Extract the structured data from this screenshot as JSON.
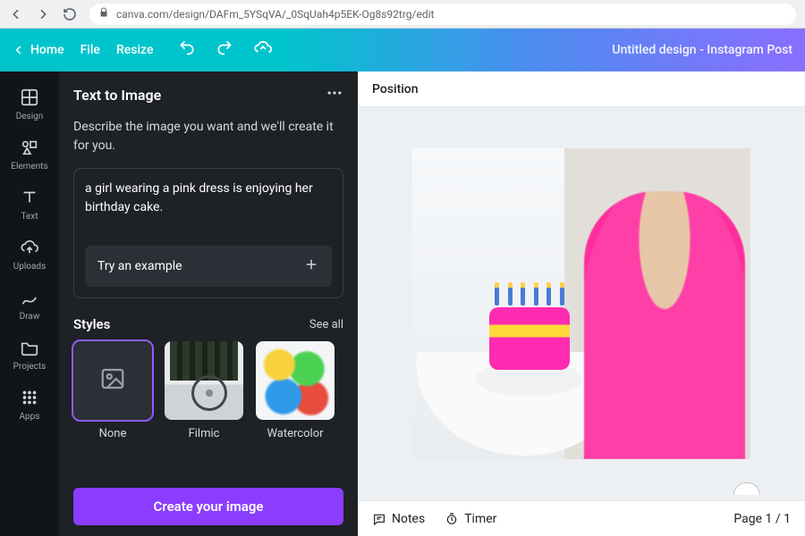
{
  "browser": {
    "url": "canva.com/design/DAFm_5YSqVA/_0SqUah4p5EK-Og8s92trg/edit"
  },
  "topbar": {
    "home": "Home",
    "file": "File",
    "resize": "Resize",
    "title": "Untitled design - Instagram Post"
  },
  "rail": {
    "design": "Design",
    "elements": "Elements",
    "text": "Text",
    "uploads": "Uploads",
    "draw": "Draw",
    "projects": "Projects",
    "apps": "Apps"
  },
  "panel": {
    "title": "Text to Image",
    "desc": "Describe the image you want and we'll create it for you.",
    "prompt": "a girl wearing a pink dress is enjoying her birthday cake.",
    "example": "Try an example",
    "styles_heading": "Styles",
    "see_all": "See all",
    "styles": {
      "none": "None",
      "filmic": "Filmic",
      "watercolor": "Watercolor"
    },
    "cta": "Create your image"
  },
  "canvas": {
    "position": "Position",
    "notes": "Notes",
    "timer": "Timer",
    "page": "Page 1 / 1"
  }
}
